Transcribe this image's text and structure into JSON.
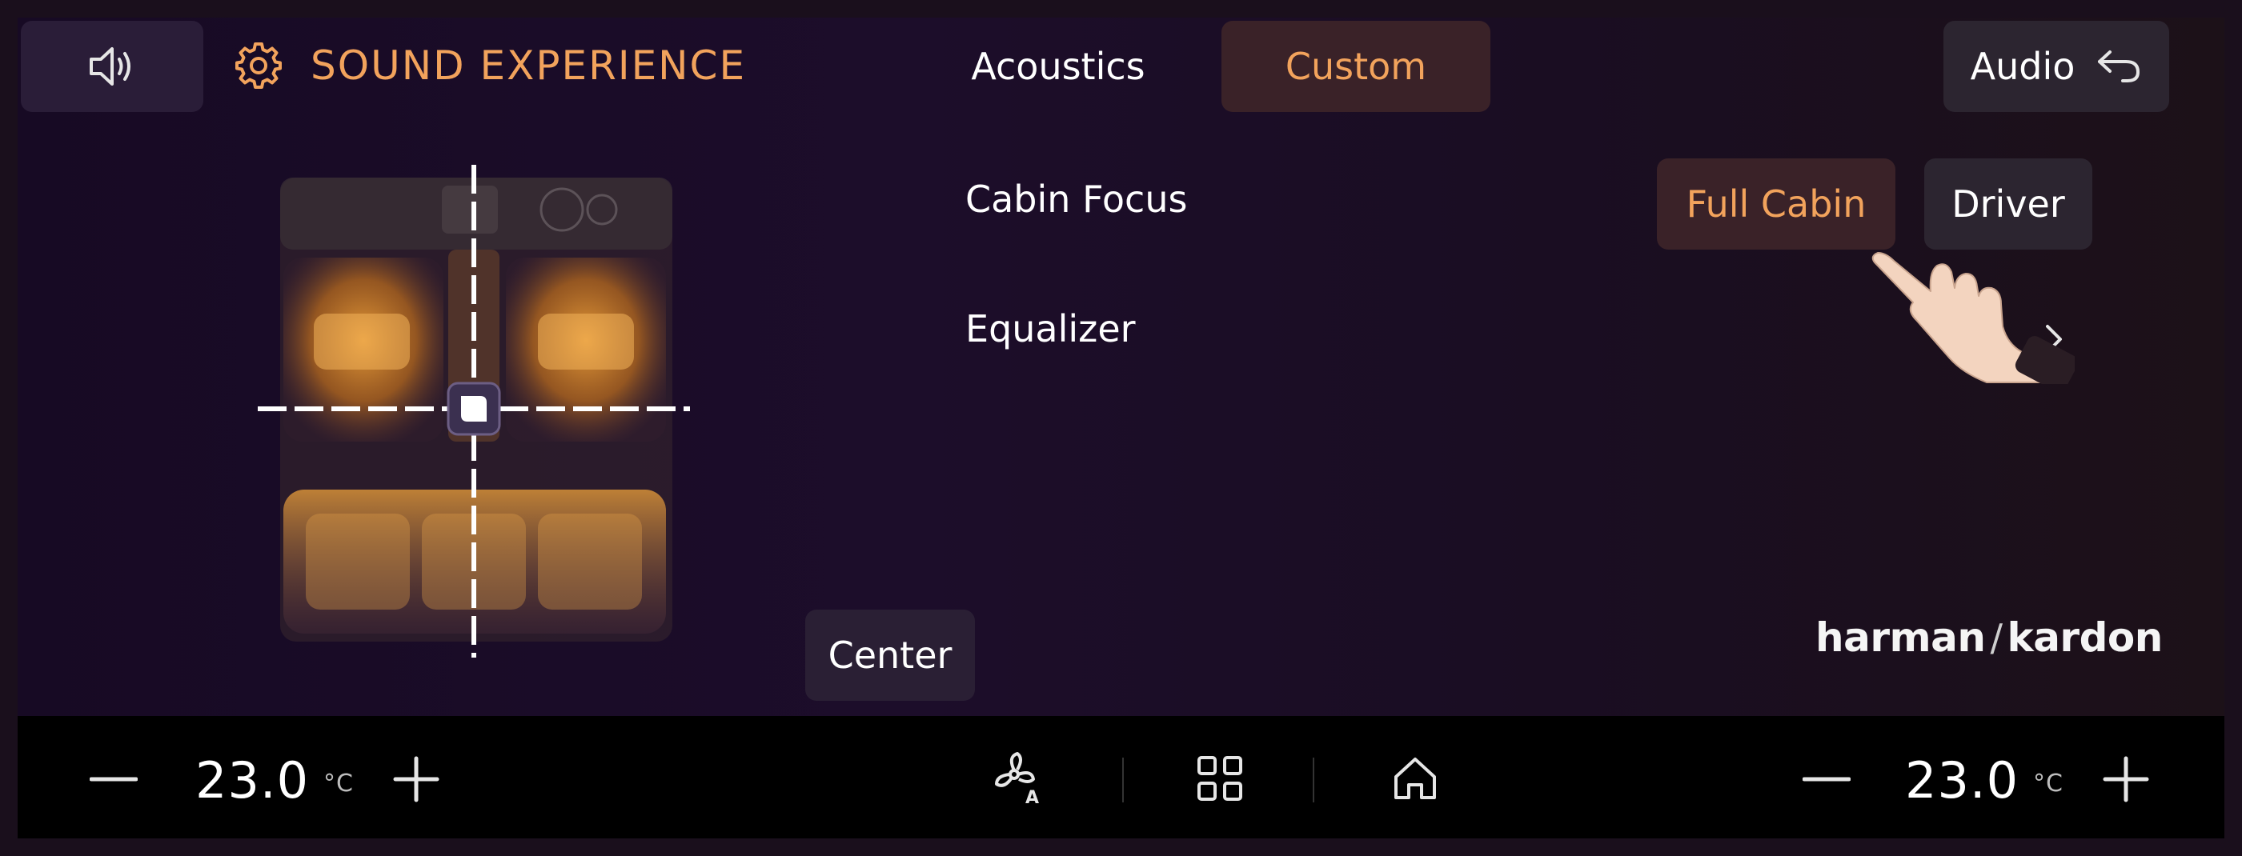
{
  "header": {
    "title": "SOUND EXPERIENCE",
    "tabs": [
      {
        "label": "Acoustics",
        "active": false
      },
      {
        "label": "Custom",
        "active": true
      }
    ],
    "audio_button_label": "Audio"
  },
  "settings": {
    "cabin_focus": {
      "label": "Cabin Focus",
      "options": [
        {
          "label": "Full Cabin",
          "selected": true
        },
        {
          "label": "Driver",
          "selected": false
        }
      ]
    },
    "equalizer": {
      "label": "Equalizer"
    }
  },
  "sound_position": {
    "button_label": "Center"
  },
  "brand": {
    "left": "harman",
    "separator": "/",
    "right": "kardon"
  },
  "climate": {
    "left": {
      "temperature": "23.0",
      "unit": "°C"
    },
    "right": {
      "temperature": "23.0",
      "unit": "°C"
    }
  },
  "icons": {
    "sound": "speaker-icon",
    "settings": "gear-icon",
    "back": "back-arrow-icon",
    "chevron": "chevron-right-icon",
    "fan": "fan-auto-icon",
    "apps": "grid-icon",
    "home": "home-icon",
    "minus": "minus-icon",
    "plus": "plus-icon"
  },
  "colors": {
    "accent": "#f2a35c",
    "selected_bg": "#3a2228",
    "button_bg": "#2c2530",
    "bottom_bar": "#000000"
  }
}
